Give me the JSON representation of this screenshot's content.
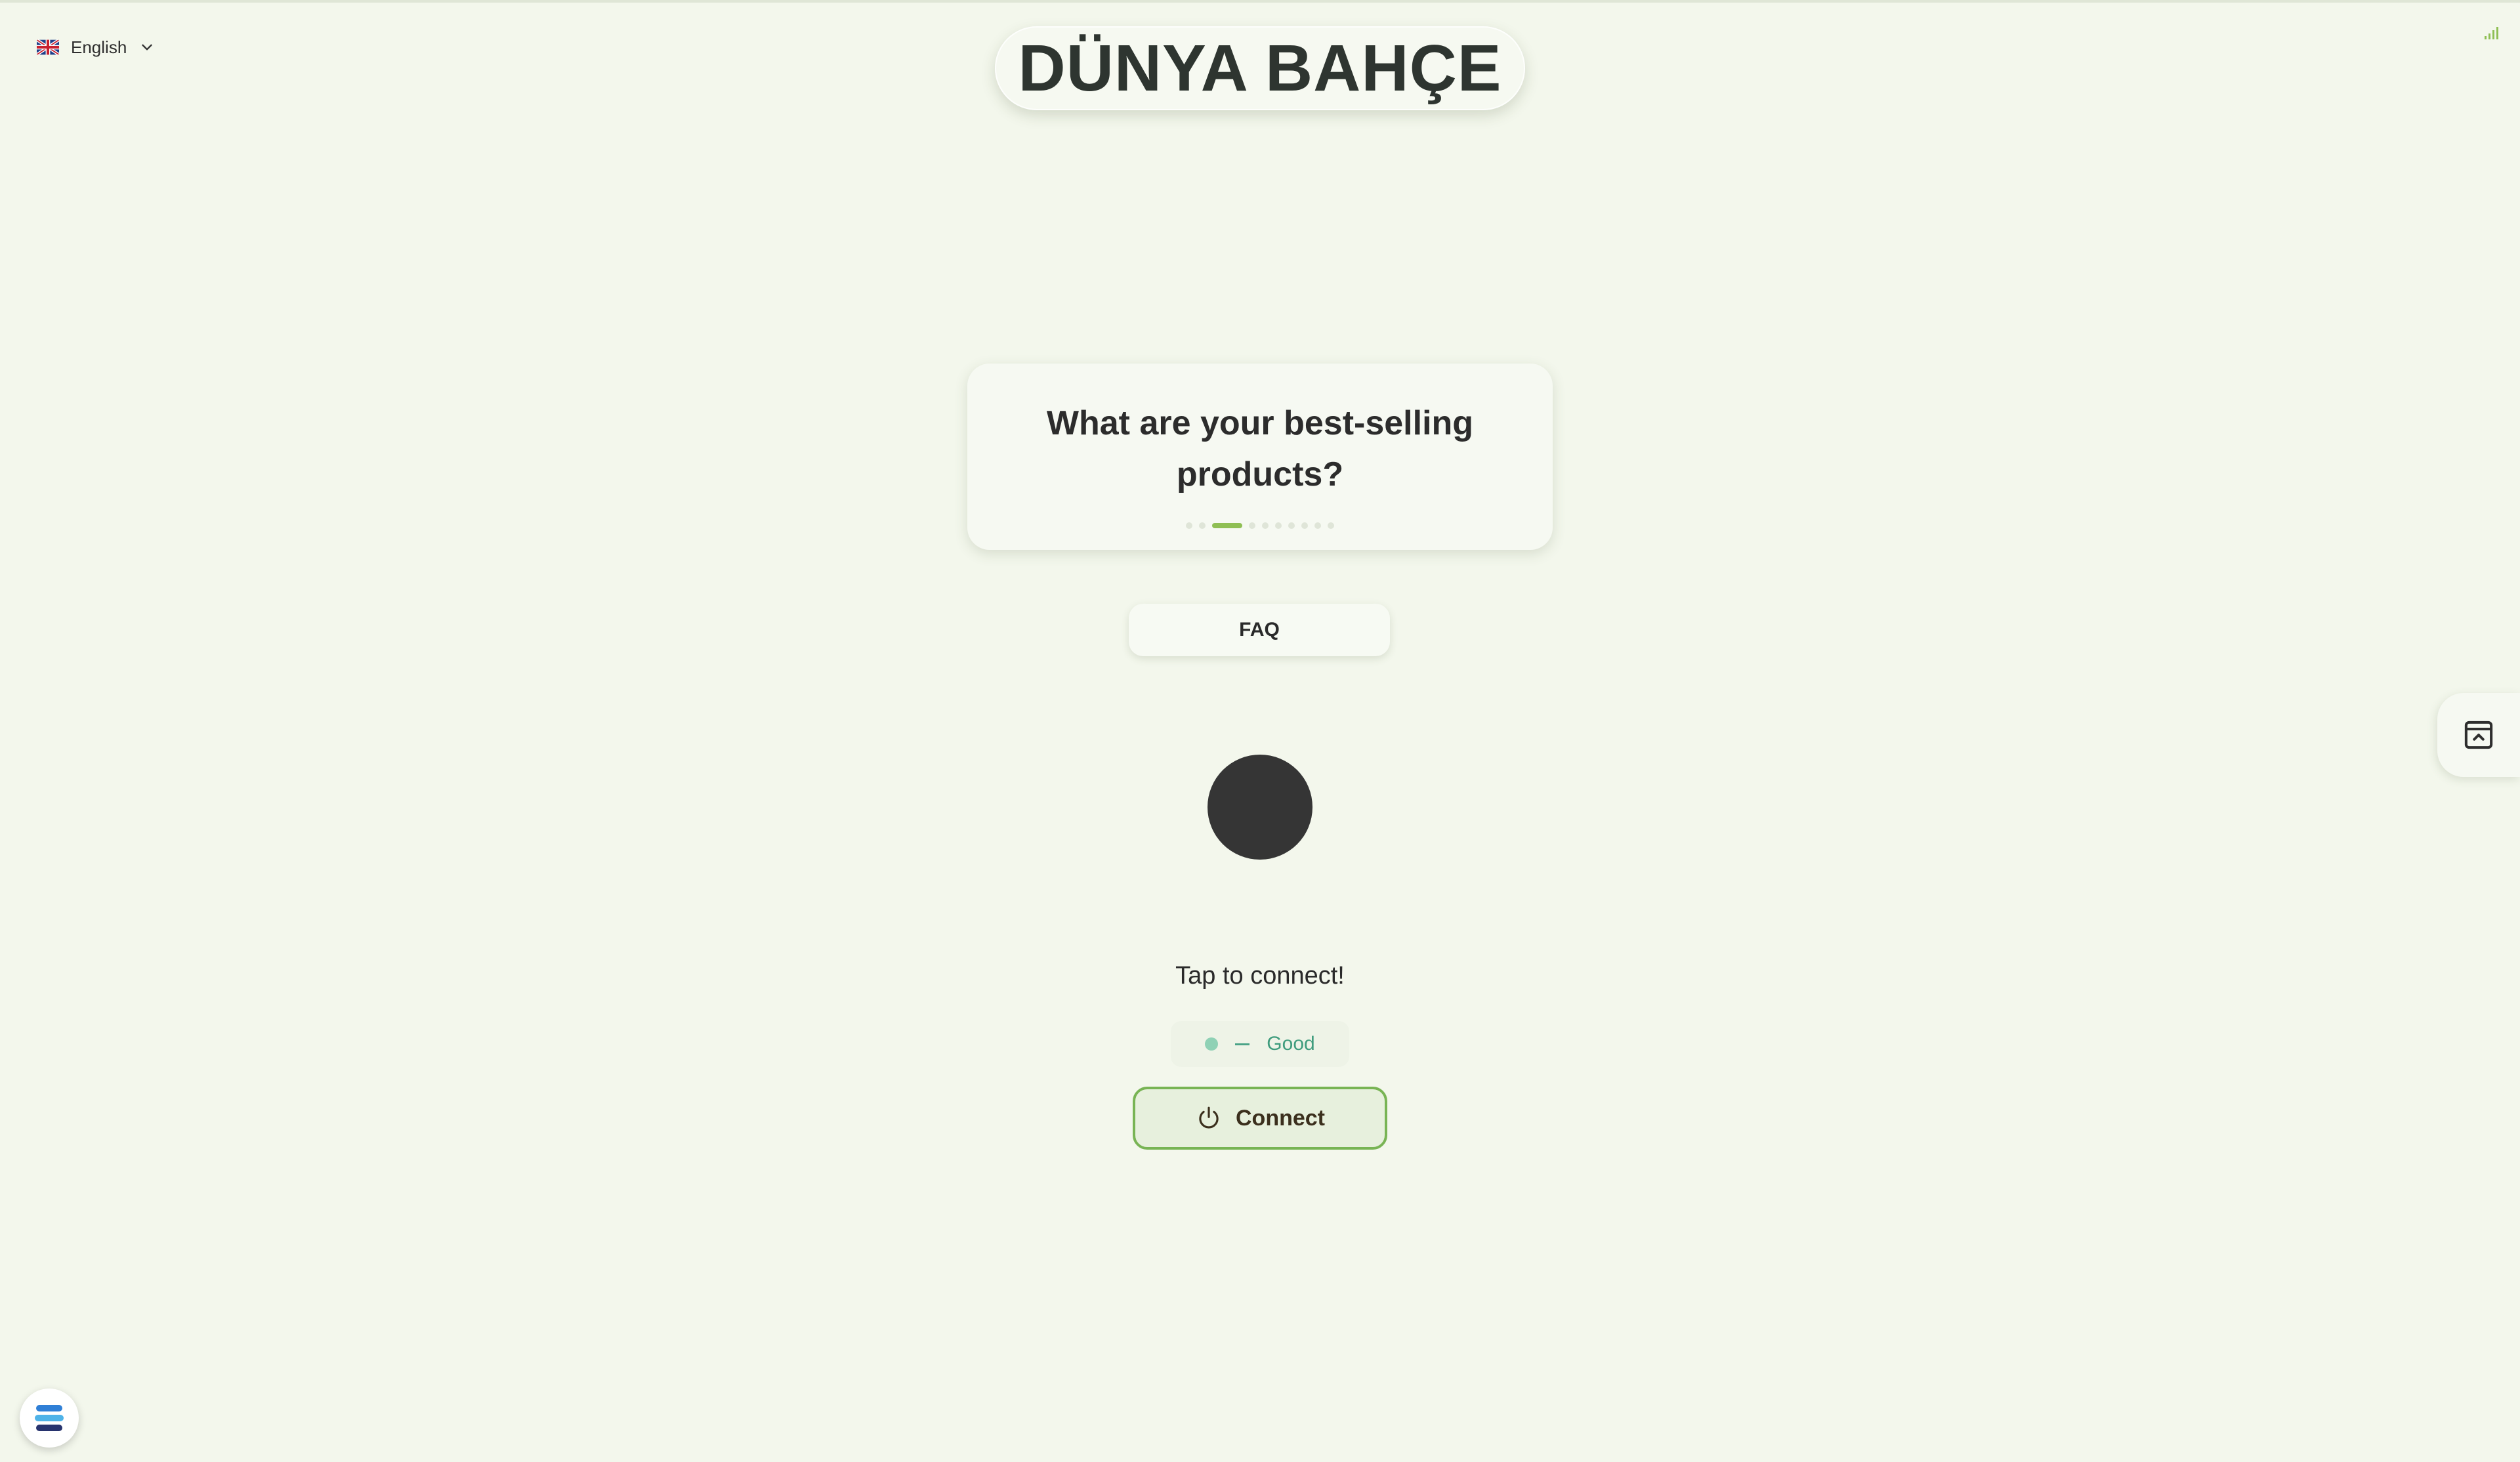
{
  "language": {
    "label": "English",
    "flag_icon": "uk-flag-icon"
  },
  "brand": {
    "title": "DÜNYA BAHÇE"
  },
  "question_card": {
    "text": "What are your best-selling products?",
    "carousel": {
      "total": 10,
      "active_index": 2
    }
  },
  "faq": {
    "label": "FAQ"
  },
  "status": {
    "tap_text": "Tap to connect!",
    "quality_label": "Good"
  },
  "connect": {
    "label": "Connect",
    "icon": "power-icon"
  },
  "icons": {
    "signal": "signal-bars-icon",
    "side_panel": "panel-toggle-icon",
    "app": "stack-logo-icon"
  },
  "colors": {
    "background": "#f3f7ec",
    "accent_green": "#78b454",
    "carousel_active": "#8fbf54",
    "quality_good": "#3f9c7d",
    "orb": "#353535"
  }
}
